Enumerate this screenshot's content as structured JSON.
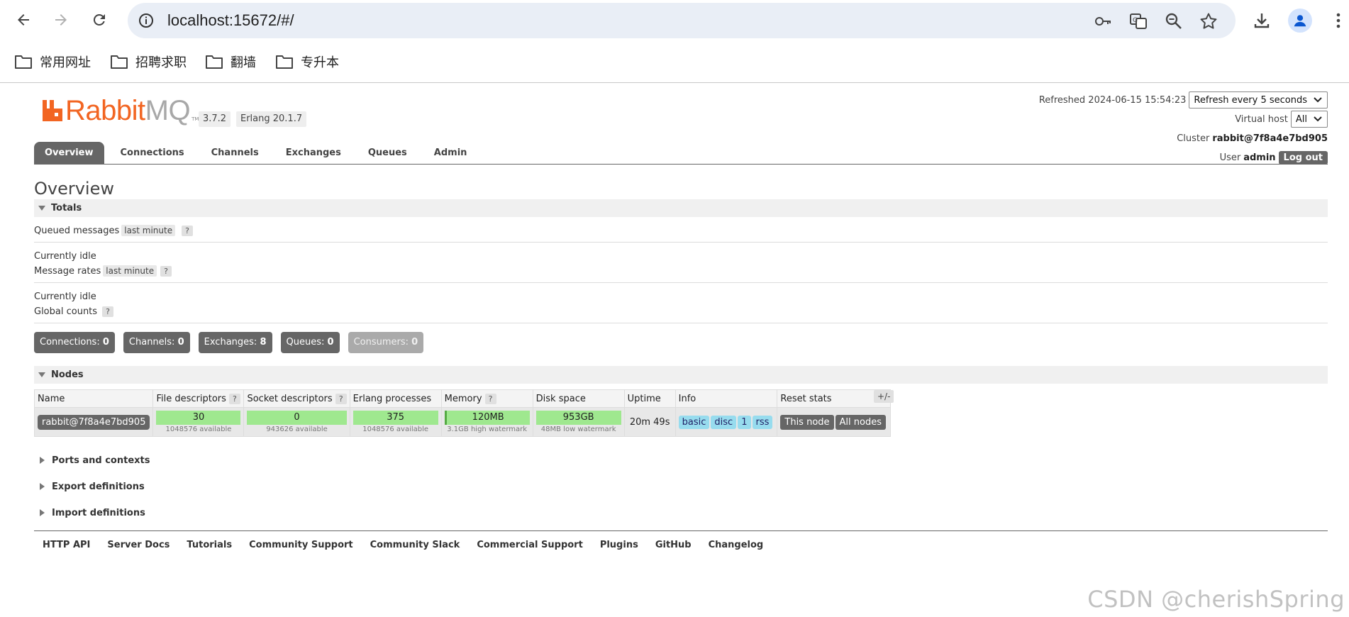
{
  "browser": {
    "url": "localhost:15672/#/",
    "bookmarks": [
      "常用网址",
      "招聘求职",
      "翻墙",
      "专升本"
    ]
  },
  "header": {
    "logo_rabbit": "Rabbit",
    "logo_mq": "MQ",
    "logo_tm": "TM",
    "version": "3.7.2",
    "erlang": "Erlang 20.1.7",
    "refreshed_label": "Refreshed 2024-06-15 15:54:23",
    "refresh_select": "Refresh every 5 seconds",
    "vhost_label": "Virtual host",
    "vhost_select": "All",
    "cluster_label": "Cluster",
    "cluster_name": "rabbit@7f8a4e7bd905",
    "user_label": "User",
    "user_name": "admin",
    "logout": "Log out"
  },
  "tabs": [
    "Overview",
    "Connections",
    "Channels",
    "Exchanges",
    "Queues",
    "Admin"
  ],
  "overview": {
    "title": "Overview",
    "totals_header": "Totals",
    "queued_label": "Queued messages",
    "queued_range": "last minute",
    "help": "?",
    "idle1": "Currently idle",
    "rates_label": "Message rates",
    "rates_range": "last minute",
    "idle2": "Currently idle",
    "global_label": "Global counts",
    "counts": [
      {
        "label": "Connections:",
        "value": "0"
      },
      {
        "label": "Channels:",
        "value": "0"
      },
      {
        "label": "Exchanges:",
        "value": "8"
      },
      {
        "label": "Queues:",
        "value": "0"
      },
      {
        "label": "Consumers:",
        "value": "0"
      }
    ]
  },
  "nodes": {
    "header": "Nodes",
    "columns": [
      "Name",
      "File descriptors",
      "Socket descriptors",
      "Erlang processes",
      "Memory",
      "Disk space",
      "Uptime",
      "Info",
      "Reset stats"
    ],
    "plusminus": "+/-",
    "row": {
      "name": "rabbit@7f8a4e7bd905",
      "fd": "30",
      "fd_sub": "1048576 available",
      "sd": "0",
      "sd_sub": "943626 available",
      "ep": "375",
      "ep_sub": "1048576 available",
      "mem": "120MB",
      "mem_sub": "3.1GB high watermark",
      "disk": "953GB",
      "disk_sub": "48MB low watermark",
      "uptime": "20m 49s",
      "info": [
        "basic",
        "disc",
        "1",
        "rss"
      ],
      "reset": [
        "This node",
        "All nodes"
      ]
    }
  },
  "collapsed": [
    "Ports and contexts",
    "Export definitions",
    "Import definitions"
  ],
  "footer": [
    "HTTP API",
    "Server Docs",
    "Tutorials",
    "Community Support",
    "Community Slack",
    "Commercial Support",
    "Plugins",
    "GitHub",
    "Changelog"
  ],
  "watermark": "CSDN @cherishSpring",
  "colors": {
    "brand": "#f26522",
    "tab_active": "#666666",
    "bar_green": "#9fe88f",
    "tag_blue": "#97dcee"
  }
}
